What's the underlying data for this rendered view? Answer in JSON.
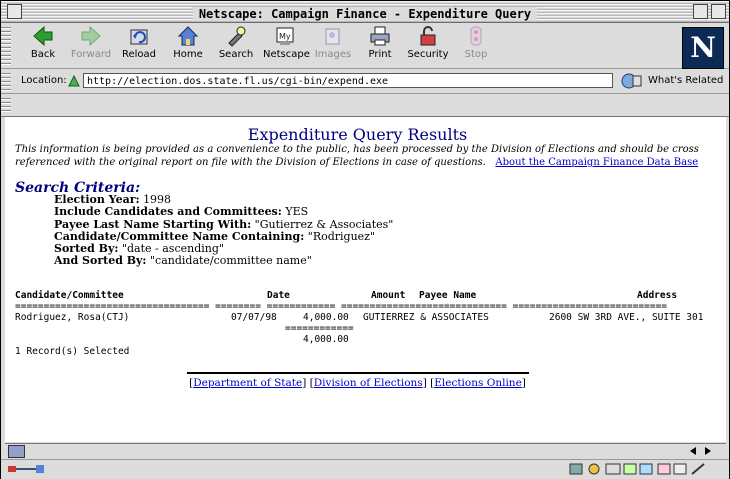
{
  "window": {
    "title": "Netscape: Campaign Finance - Expenditure Query"
  },
  "toolbar": {
    "back": "Back",
    "forward": "Forward",
    "reload": "Reload",
    "home": "Home",
    "search": "Search",
    "netscape": "Netscape",
    "images": "Images",
    "print": "Print",
    "security": "Security",
    "stop": "Stop"
  },
  "location": {
    "label": "Location:",
    "url": "http://election.dos.state.fl.us/cgi-bin/expend.exe",
    "related": "What's Related"
  },
  "page": {
    "heading": "Expenditure Query Results",
    "disclaimer": "This information is being provided as a convenience to the public, has been processed by the Division of Elections and should be cross referenced with the original report on file with the Division of Elections in case of questions.",
    "about_link": "About the Campaign Finance Data Base",
    "criteria_title": "Search Criteria:",
    "criteria": [
      {
        "label": "Election Year:",
        "value": "1998"
      },
      {
        "label": "Include Candidates and Committees:",
        "value": "YES"
      },
      {
        "label": "Payee Last Name Starting With:",
        "value": "\"Gutierrez & Associates\""
      },
      {
        "label": "Candidate/Committee Name Containing:",
        "value": "\"Rodriguez\""
      },
      {
        "label": "Sorted By:",
        "value": "\"date - ascending\""
      },
      {
        "label": "And Sorted By:",
        "value": "\"candidate/committee name\""
      }
    ],
    "table": {
      "headers": {
        "candidate": "Candidate/Committee",
        "date": "Date",
        "amount": "Amount",
        "payee": "Payee Name",
        "address": "Address"
      },
      "rule_line": "================================== ======== ============ ============================= ===========================",
      "row": {
        "candidate": "Rodriguez, Rosa(CTJ)",
        "date": "07/07/98",
        "amount": "4,000.00",
        "payee": "GUTIERREZ & ASSOCIATES",
        "address": "2600 SW 3RD AVE., SUITE 301"
      },
      "total_rule": "============",
      "total": "4,000.00",
      "records": "1 Record(s) Selected"
    },
    "footer_links": [
      "Department of State",
      "Division of Elections",
      "Elections Online"
    ]
  },
  "colors": {
    "heading": "#000080",
    "link": "#0000cc",
    "criteria": "#000080"
  }
}
